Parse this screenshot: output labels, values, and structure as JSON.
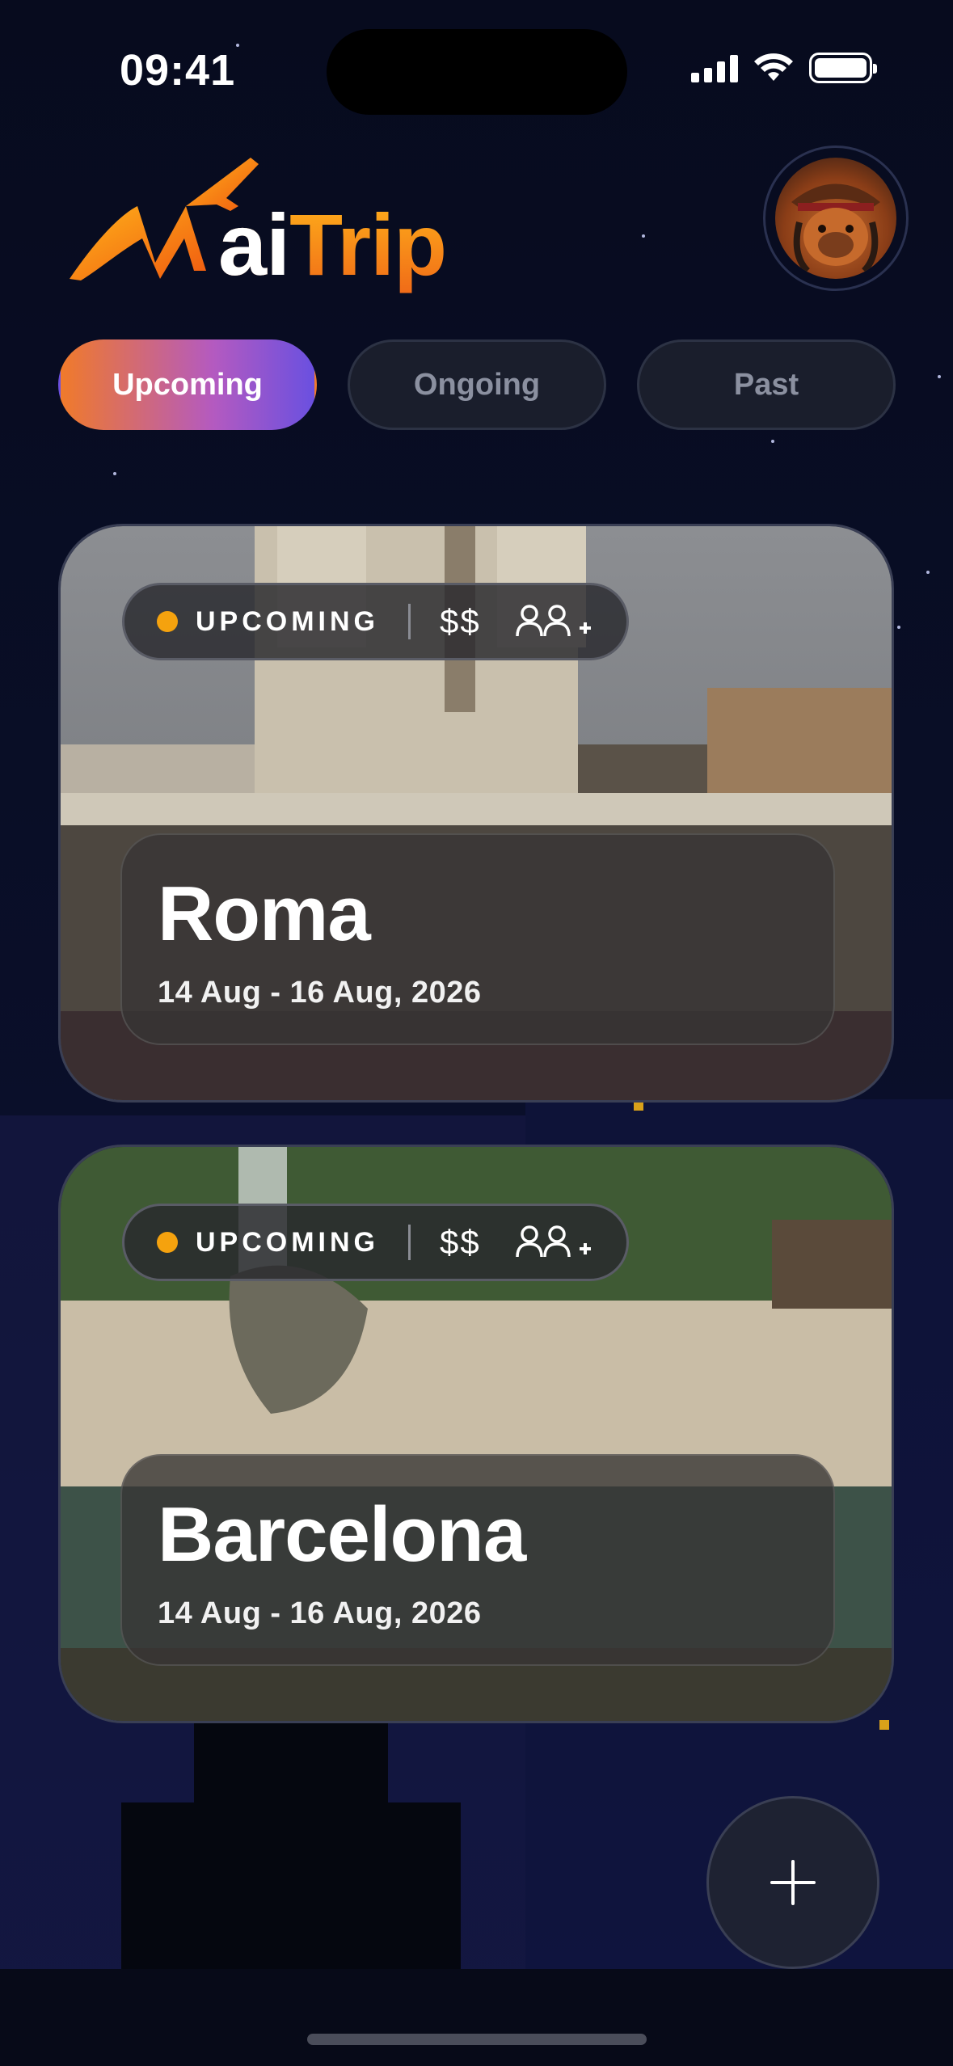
{
  "status_bar": {
    "time": "09:41"
  },
  "header": {
    "logo_prefix": "ai",
    "logo_suffix": "Trip",
    "avatar": "capybara-pirate-avatar"
  },
  "tabs": [
    {
      "label": "Upcoming",
      "active": true
    },
    {
      "label": "Ongoing",
      "active": false
    },
    {
      "label": "Past",
      "active": false
    }
  ],
  "trips": [
    {
      "status": "UPCOMING",
      "price": "$$",
      "travelers_icon": "group-add-icon",
      "city": "Roma",
      "dates": "14 Aug - 16 Aug, 2026"
    },
    {
      "status": "UPCOMING",
      "price": "$$",
      "travelers_icon": "group-add-icon",
      "city": "Barcelona",
      "dates": "14 Aug - 16 Aug, 2026"
    }
  ],
  "fab": {
    "icon": "plus-icon"
  },
  "colors": {
    "background": "#060a1c",
    "accent_orange": "#f07a2a",
    "accent_purple": "#6a50e0",
    "status_dot": "#f5a20e"
  }
}
